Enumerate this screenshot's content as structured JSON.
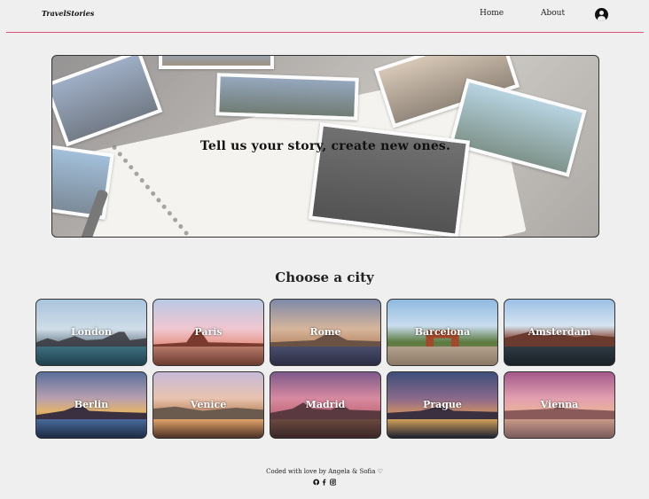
{
  "nav": {
    "brand": "TravelStories",
    "links": [
      {
        "label": "Home"
      },
      {
        "label": "About"
      }
    ],
    "account_icon": "user-circle-icon",
    "accent_color": "#d9527a"
  },
  "hero": {
    "tagline": "Tell us your story, create new ones."
  },
  "cities": {
    "title": "Choose a city",
    "items": [
      {
        "name": "London"
      },
      {
        "name": "Paris"
      },
      {
        "name": "Rome"
      },
      {
        "name": "Barcelona"
      },
      {
        "name": "Amsterdam"
      },
      {
        "name": "Berlin"
      },
      {
        "name": "Venice"
      },
      {
        "name": "Madrid"
      },
      {
        "name": "Prague"
      },
      {
        "name": "Vienna"
      }
    ]
  },
  "footer": {
    "credit": "Coded with love by Angela & Sofia ♡",
    "social_icons": [
      "github-icon",
      "facebook-icon",
      "instagram-icon"
    ]
  }
}
